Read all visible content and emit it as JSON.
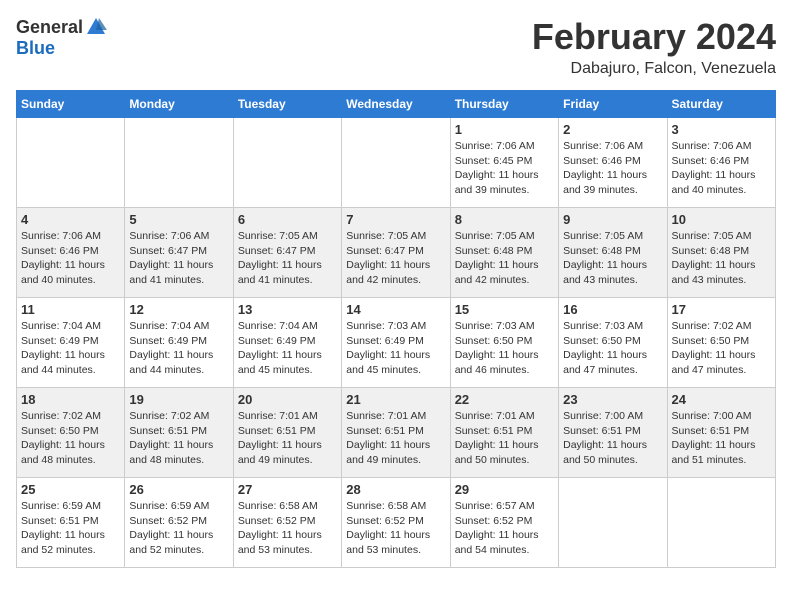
{
  "header": {
    "logo_general": "General",
    "logo_blue": "Blue",
    "month_title": "February 2024",
    "location": "Dabajuro, Falcon, Venezuela"
  },
  "days_of_week": [
    "Sunday",
    "Monday",
    "Tuesday",
    "Wednesday",
    "Thursday",
    "Friday",
    "Saturday"
  ],
  "weeks": [
    [
      {
        "day": "",
        "info": ""
      },
      {
        "day": "",
        "info": ""
      },
      {
        "day": "",
        "info": ""
      },
      {
        "day": "",
        "info": ""
      },
      {
        "day": "1",
        "info": "Sunrise: 7:06 AM\nSunset: 6:45 PM\nDaylight: 11 hours\nand 39 minutes."
      },
      {
        "day": "2",
        "info": "Sunrise: 7:06 AM\nSunset: 6:46 PM\nDaylight: 11 hours\nand 39 minutes."
      },
      {
        "day": "3",
        "info": "Sunrise: 7:06 AM\nSunset: 6:46 PM\nDaylight: 11 hours\nand 40 minutes."
      }
    ],
    [
      {
        "day": "4",
        "info": "Sunrise: 7:06 AM\nSunset: 6:46 PM\nDaylight: 11 hours\nand 40 minutes."
      },
      {
        "day": "5",
        "info": "Sunrise: 7:06 AM\nSunset: 6:47 PM\nDaylight: 11 hours\nand 41 minutes."
      },
      {
        "day": "6",
        "info": "Sunrise: 7:05 AM\nSunset: 6:47 PM\nDaylight: 11 hours\nand 41 minutes."
      },
      {
        "day": "7",
        "info": "Sunrise: 7:05 AM\nSunset: 6:47 PM\nDaylight: 11 hours\nand 42 minutes."
      },
      {
        "day": "8",
        "info": "Sunrise: 7:05 AM\nSunset: 6:48 PM\nDaylight: 11 hours\nand 42 minutes."
      },
      {
        "day": "9",
        "info": "Sunrise: 7:05 AM\nSunset: 6:48 PM\nDaylight: 11 hours\nand 43 minutes."
      },
      {
        "day": "10",
        "info": "Sunrise: 7:05 AM\nSunset: 6:48 PM\nDaylight: 11 hours\nand 43 minutes."
      }
    ],
    [
      {
        "day": "11",
        "info": "Sunrise: 7:04 AM\nSunset: 6:49 PM\nDaylight: 11 hours\nand 44 minutes."
      },
      {
        "day": "12",
        "info": "Sunrise: 7:04 AM\nSunset: 6:49 PM\nDaylight: 11 hours\nand 44 minutes."
      },
      {
        "day": "13",
        "info": "Sunrise: 7:04 AM\nSunset: 6:49 PM\nDaylight: 11 hours\nand 45 minutes."
      },
      {
        "day": "14",
        "info": "Sunrise: 7:03 AM\nSunset: 6:49 PM\nDaylight: 11 hours\nand 45 minutes."
      },
      {
        "day": "15",
        "info": "Sunrise: 7:03 AM\nSunset: 6:50 PM\nDaylight: 11 hours\nand 46 minutes."
      },
      {
        "day": "16",
        "info": "Sunrise: 7:03 AM\nSunset: 6:50 PM\nDaylight: 11 hours\nand 47 minutes."
      },
      {
        "day": "17",
        "info": "Sunrise: 7:02 AM\nSunset: 6:50 PM\nDaylight: 11 hours\nand 47 minutes."
      }
    ],
    [
      {
        "day": "18",
        "info": "Sunrise: 7:02 AM\nSunset: 6:50 PM\nDaylight: 11 hours\nand 48 minutes."
      },
      {
        "day": "19",
        "info": "Sunrise: 7:02 AM\nSunset: 6:51 PM\nDaylight: 11 hours\nand 48 minutes."
      },
      {
        "day": "20",
        "info": "Sunrise: 7:01 AM\nSunset: 6:51 PM\nDaylight: 11 hours\nand 49 minutes."
      },
      {
        "day": "21",
        "info": "Sunrise: 7:01 AM\nSunset: 6:51 PM\nDaylight: 11 hours\nand 49 minutes."
      },
      {
        "day": "22",
        "info": "Sunrise: 7:01 AM\nSunset: 6:51 PM\nDaylight: 11 hours\nand 50 minutes."
      },
      {
        "day": "23",
        "info": "Sunrise: 7:00 AM\nSunset: 6:51 PM\nDaylight: 11 hours\nand 50 minutes."
      },
      {
        "day": "24",
        "info": "Sunrise: 7:00 AM\nSunset: 6:51 PM\nDaylight: 11 hours\nand 51 minutes."
      }
    ],
    [
      {
        "day": "25",
        "info": "Sunrise: 6:59 AM\nSunset: 6:51 PM\nDaylight: 11 hours\nand 52 minutes."
      },
      {
        "day": "26",
        "info": "Sunrise: 6:59 AM\nSunset: 6:52 PM\nDaylight: 11 hours\nand 52 minutes."
      },
      {
        "day": "27",
        "info": "Sunrise: 6:58 AM\nSunset: 6:52 PM\nDaylight: 11 hours\nand 53 minutes."
      },
      {
        "day": "28",
        "info": "Sunrise: 6:58 AM\nSunset: 6:52 PM\nDaylight: 11 hours\nand 53 minutes."
      },
      {
        "day": "29",
        "info": "Sunrise: 6:57 AM\nSunset: 6:52 PM\nDaylight: 11 hours\nand 54 minutes."
      },
      {
        "day": "",
        "info": ""
      },
      {
        "day": "",
        "info": ""
      }
    ]
  ]
}
